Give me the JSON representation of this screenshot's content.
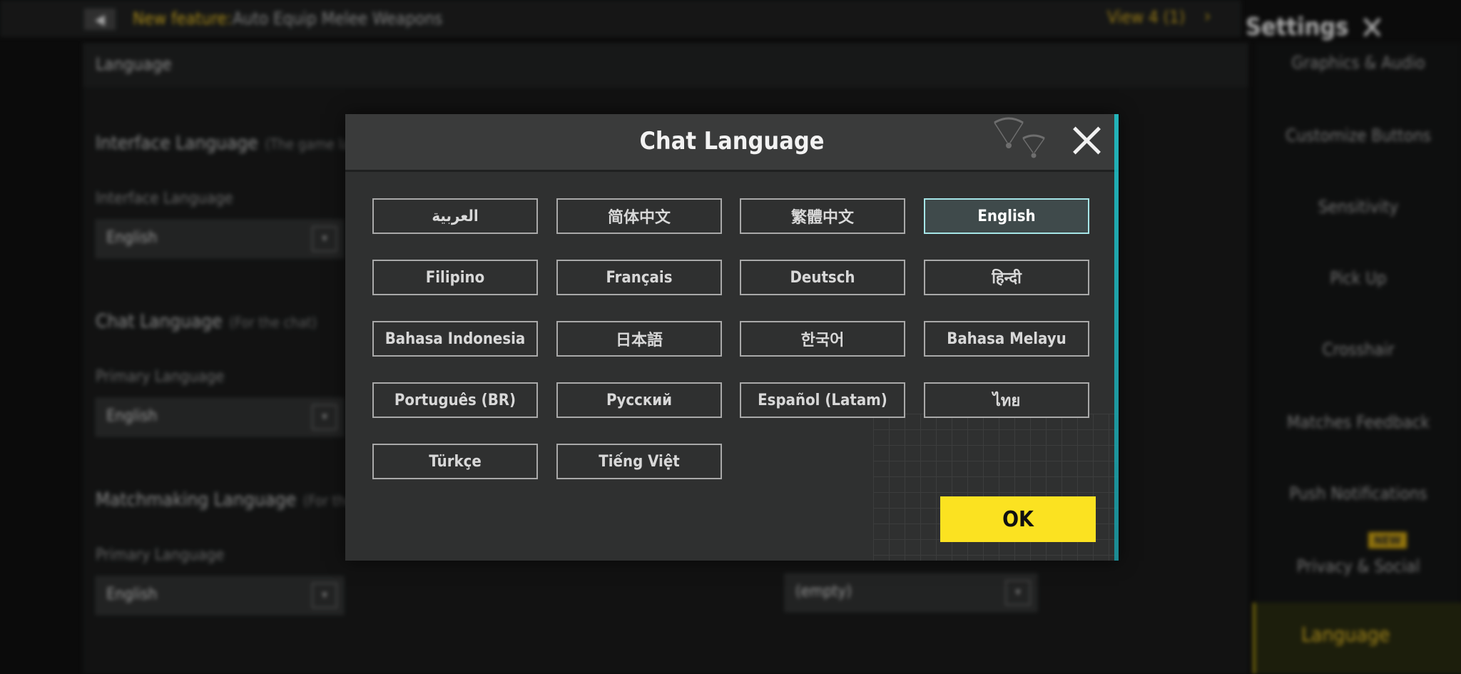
{
  "background": {
    "news_tag": "New feature:",
    "news_text": "Auto Equip Melee Weapons",
    "view_link": "View 4 (1)",
    "settings_title": "Settings",
    "section_header": "Language",
    "interface_language": {
      "label": "Interface Language",
      "hint": "(The game language)",
      "sub_label": "Interface Language",
      "value": "English"
    },
    "chat_language": {
      "label": "Chat Language",
      "hint": "(For the chat)",
      "sub_label": "Primary Language",
      "value": "English"
    },
    "matchmaking_language": {
      "label": "Matchmaking Language",
      "hint": "(For the match)",
      "sub_label": "Primary Language",
      "value": "English"
    },
    "secondary_dropdown_value": "(empty)",
    "sidebar": [
      "Graphics & Audio",
      "Customize Buttons",
      "Sensitivity",
      "Pick Up",
      "Crosshair",
      "Matches Feedback",
      "Push Notifications",
      "Privacy & Social",
      "Language"
    ],
    "new_badge": "NEW"
  },
  "dialog": {
    "title": "Chat Language",
    "selected": "English",
    "languages": [
      "العربية",
      "简体中文",
      "繁體中文",
      "English",
      "Filipino",
      "Français",
      "Deutsch",
      "हिन्दी",
      "Bahasa Indonesia",
      "日本語",
      "한국어",
      "Bahasa Melayu",
      "Português (BR)",
      "Русский",
      "Español (Latam)",
      "ไทย",
      "Türkçe",
      "Tiếng Việt"
    ],
    "ok_label": "OK"
  },
  "colors": {
    "accent_yellow": "#fbe221",
    "selected_border": "#a6e6e8",
    "edge_glow": "#1fc9d0"
  }
}
